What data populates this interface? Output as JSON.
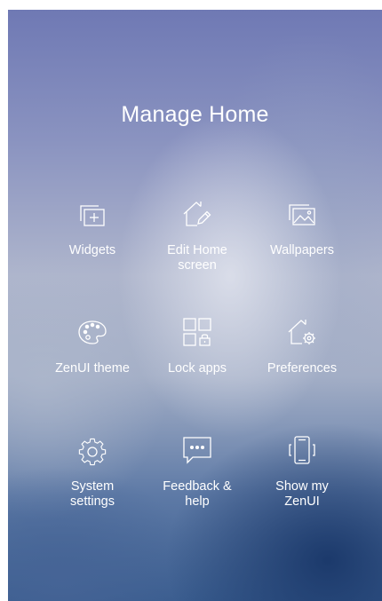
{
  "title": "Manage Home",
  "tiles": [
    {
      "label": "Widgets",
      "icon": "widgets-icon"
    },
    {
      "label": "Edit Home\nscreen",
      "icon": "edit-home-icon"
    },
    {
      "label": "Wallpapers",
      "icon": "wallpapers-icon"
    },
    {
      "label": "ZenUI theme",
      "icon": "palette-icon"
    },
    {
      "label": "Lock apps",
      "icon": "lock-apps-icon"
    },
    {
      "label": "Preferences",
      "icon": "home-gear-icon"
    },
    {
      "label": "System\nsettings",
      "icon": "gear-icon"
    },
    {
      "label": "Feedback &\nhelp",
      "icon": "chat-bubble-icon"
    },
    {
      "label": "Show my\nZenUI",
      "icon": "phone-vibrate-icon"
    }
  ],
  "colors": {
    "text": "#ffffff",
    "icon_stroke": "#ffffff"
  }
}
